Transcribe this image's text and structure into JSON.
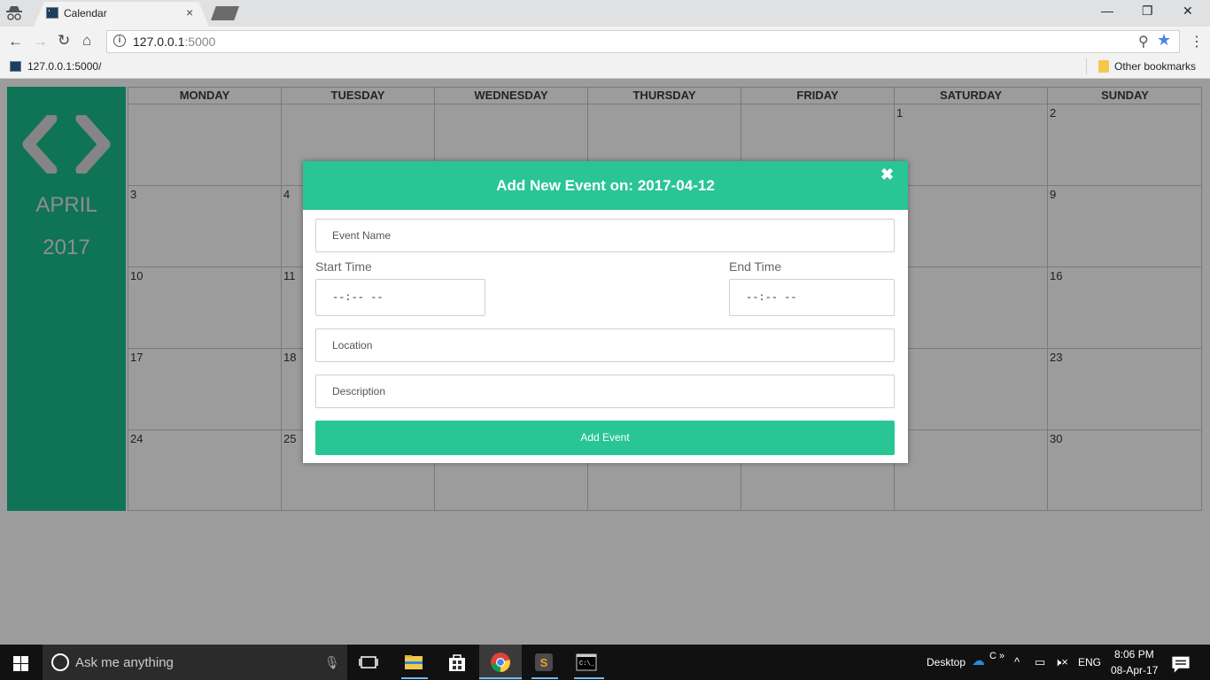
{
  "browser": {
    "tab_title": "Calendar",
    "tab_close": "×",
    "url_host": "127.0.0.1",
    "url_port": ":5000",
    "bookmark": "127.0.0.1:5000/",
    "other_bookmarks": "Other bookmarks",
    "window_buttons": [
      "—",
      "❐",
      "✕"
    ]
  },
  "calendar": {
    "month": "APRIL",
    "year": "2017",
    "prev_label": "‹",
    "next_label": "›",
    "weekdays": [
      "MONDAY",
      "TUESDAY",
      "WEDNESDAY",
      "THURSDAY",
      "FRIDAY",
      "SATURDAY",
      "SUNDAY"
    ],
    "weeks": [
      [
        "",
        "",
        "",
        "",
        "",
        "1",
        "2"
      ],
      [
        "3",
        "4",
        "",
        "",
        "",
        "",
        "9"
      ],
      [
        "10",
        "11",
        "",
        "",
        "",
        "",
        "16"
      ],
      [
        "17",
        "18",
        "",
        "",
        "",
        "",
        "23"
      ],
      [
        "24",
        "25",
        "",
        "",
        "",
        "",
        "30"
      ]
    ]
  },
  "modal": {
    "title": "Add New Event on: 2017-04-12",
    "close": "✖",
    "event_name_placeholder": "Event Name",
    "start_time_label": "Start Time",
    "end_time_label": "End Time",
    "start_time_value": "--:-- --",
    "end_time_value": "--:-- --",
    "location_placeholder": "Location",
    "description_placeholder": "Description",
    "submit_label": "Add Event"
  },
  "taskbar": {
    "search_placeholder": "Ask me anything",
    "desktop_label": "Desktop",
    "language": "ENG",
    "time": "8:06 PM",
    "date": "08-Apr-17",
    "accent": "#76b9ed"
  },
  "colors": {
    "accent": "#2ac594",
    "sidebar": "#1abc8c"
  }
}
